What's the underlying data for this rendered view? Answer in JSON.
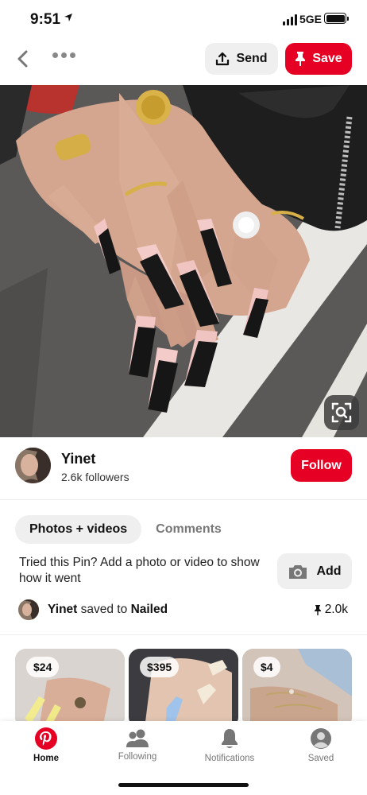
{
  "status_bar": {
    "time": "9:51",
    "network": "5GE"
  },
  "top_bar": {
    "send_label": "Send",
    "save_label": "Save"
  },
  "creator": {
    "name": "Yinet",
    "followers": "2.6k followers",
    "follow_label": "Follow"
  },
  "tabs": [
    {
      "label": "Photos + videos",
      "active": true
    },
    {
      "label": "Comments",
      "active": false
    }
  ],
  "tried": {
    "text": "Tried this Pin? Add a photo or video to show how it went",
    "add_label": "Add"
  },
  "saved": {
    "user": "Yinet",
    "middle": "saved to",
    "board": "Nailed",
    "count": "2.0k"
  },
  "related": [
    {
      "price": "$24"
    },
    {
      "price": "$395"
    },
    {
      "price": "$4"
    }
  ],
  "bottom_nav": [
    {
      "label": "Home",
      "icon": "pinterest-logo-icon",
      "active": true
    },
    {
      "label": "Following",
      "icon": "people-icon",
      "active": false
    },
    {
      "label": "Notifications",
      "icon": "bell-icon",
      "active": false
    },
    {
      "label": "Saved",
      "icon": "profile-icon",
      "active": false
    }
  ],
  "colors": {
    "brand_red": "#e60023",
    "button_gray": "#efefef",
    "muted_text": "#777777"
  }
}
